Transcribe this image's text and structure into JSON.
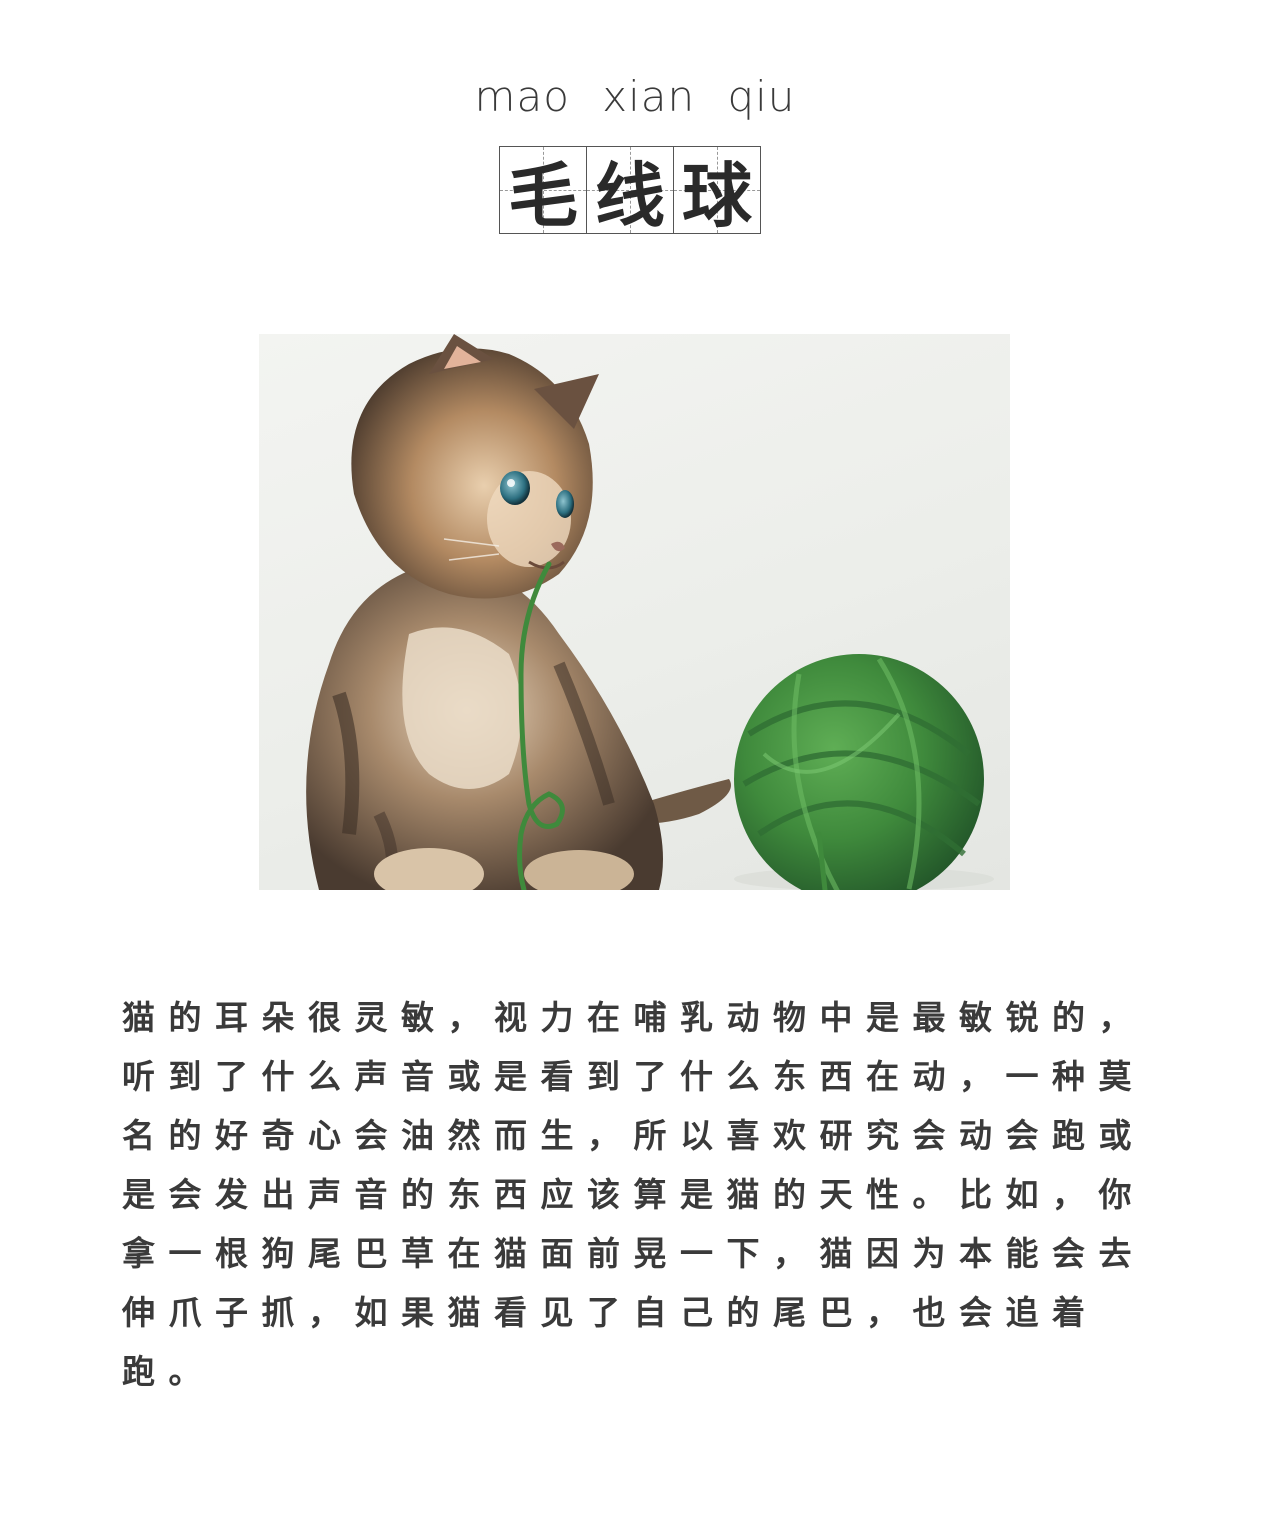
{
  "header": {
    "pinyin": "mao  xian  qiu",
    "title_chars": [
      "毛",
      "线",
      "球"
    ]
  },
  "photo": {
    "subject": "kitten",
    "object": "yarn ball",
    "yarn_color": "#3f8a3c",
    "background_color": "#eef0ec"
  },
  "article": {
    "paragraph": "猫的耳朵很灵敏，视力在哺乳动物中是最敏锐的，听到了什么声音或是看到了什么东西在动，一种莫名的好奇心会油然而生，所以喜欢研究会动会跑或是会发出声音的东西应该算是猫的天性。比如，你拿一根狗尾巴草在猫面前晃一下，猫因为本能会去伸爪子抓，如果猫看见了自己的尾巴，也会追着跑。"
  }
}
